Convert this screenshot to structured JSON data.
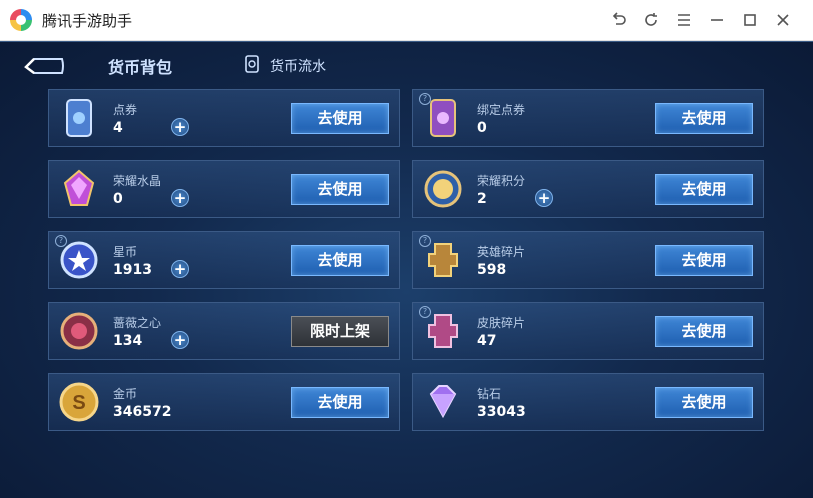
{
  "window": {
    "title": "腾讯手游助手"
  },
  "header": {
    "title": "货币背包",
    "flow_label": "货币流水"
  },
  "cards": [
    {
      "name": "点券",
      "amount": "4",
      "button": "去使用",
      "has_plus": true,
      "icon": "ticket-icon"
    },
    {
      "name": "绑定点券",
      "amount": "0",
      "button": "去使用",
      "has_plus": false,
      "icon": "bound-ticket-icon"
    },
    {
      "name": "荣耀水晶",
      "amount": "0",
      "button": "去使用",
      "has_plus": true,
      "icon": "crystal-icon"
    },
    {
      "name": "荣耀积分",
      "amount": "2",
      "button": "去使用",
      "has_plus": true,
      "icon": "honor-points-icon"
    },
    {
      "name": "星币",
      "amount": "1913",
      "button": "去使用",
      "has_plus": true,
      "icon": "star-coin-icon"
    },
    {
      "name": "英雄碎片",
      "amount": "598",
      "button": "去使用",
      "has_plus": false,
      "icon": "hero-shard-icon"
    },
    {
      "name": "蔷薇之心",
      "amount": "134",
      "button": "限时上架",
      "has_plus": true,
      "icon": "rose-heart-icon"
    },
    {
      "name": "皮肤碎片",
      "amount": "47",
      "button": "去使用",
      "has_plus": false,
      "icon": "skin-shard-icon"
    },
    {
      "name": "金币",
      "amount": "346572",
      "button": "去使用",
      "has_plus": false,
      "icon": "gold-coin-icon"
    },
    {
      "name": "钻石",
      "amount": "33043",
      "button": "去使用",
      "has_plus": false,
      "icon": "diamond-icon"
    }
  ]
}
